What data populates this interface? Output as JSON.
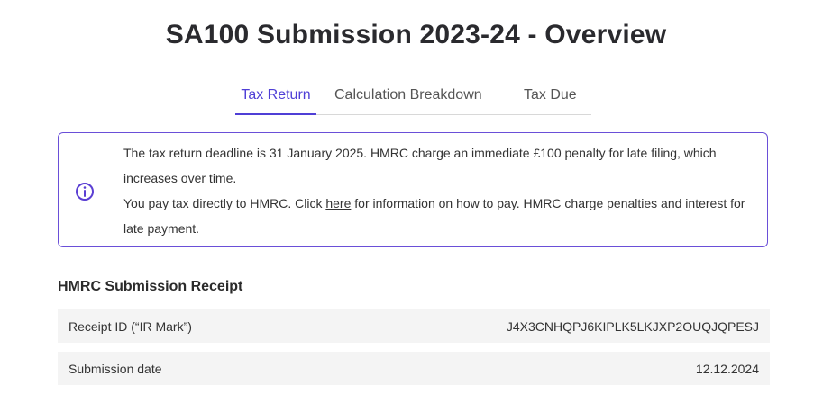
{
  "header": {
    "title": "SA100 Submission 2023-24 - Overview"
  },
  "tabs": [
    {
      "label": "Tax Return",
      "active": true
    },
    {
      "label": "Calculation Breakdown",
      "active": false
    },
    {
      "label": "Tax Due",
      "active": false
    }
  ],
  "notice": {
    "icon": "info-icon",
    "line1": "The tax return deadline is 31 January 2025. HMRC charge an immediate £100 penalty for late filing, which increases over time.",
    "line2_before": "You pay tax directly to HMRC. Click ",
    "line2_link": "here",
    "line2_after": " for information on how to pay. HMRC charge penalties and interest for late payment."
  },
  "receipt": {
    "title": "HMRC Submission Receipt",
    "rows": [
      {
        "label": "Receipt ID (“IR Mark”)",
        "value": "J4X3CNHQPJ6KIPLK5LKJXP2OUQJQPESJ"
      },
      {
        "label": "Submission date",
        "value": "12.12.2024"
      }
    ]
  },
  "colors": {
    "accent": "#4f3fd6",
    "border": "#6a4fd8",
    "row_bg": "#f4f4f4"
  }
}
